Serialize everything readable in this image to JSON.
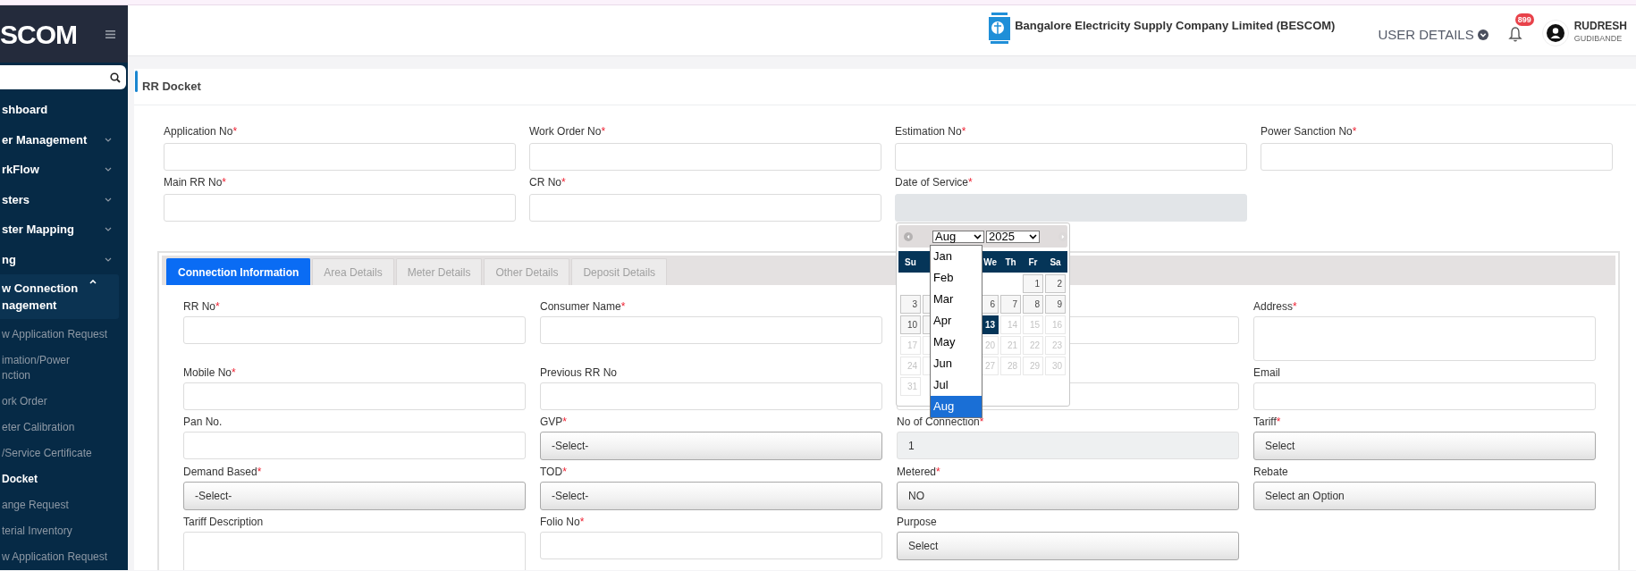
{
  "sidebar": {
    "brand": "SCOM",
    "items": [
      {
        "kind": "link",
        "lines": [
          "shboard"
        ]
      },
      {
        "kind": "group",
        "lines": [
          "er Management"
        ],
        "expanded": false
      },
      {
        "kind": "group",
        "lines": [
          "rkFlow"
        ],
        "expanded": false
      },
      {
        "kind": "group",
        "lines": [
          "sters"
        ],
        "expanded": false
      },
      {
        "kind": "group",
        "lines": [
          "ster Mapping"
        ],
        "expanded": false
      },
      {
        "kind": "group",
        "lines": [
          "ng"
        ],
        "expanded": false
      },
      {
        "kind": "group",
        "lines": [
          "w Connection",
          "nagement"
        ],
        "expanded": true,
        "children": [
          {
            "lines": [
              "w Application Request"
            ],
            "selected": false
          },
          {
            "lines": [
              "imation/Power",
              "nction"
            ],
            "selected": false
          },
          {
            "lines": [
              "ork Order"
            ],
            "selected": false
          },
          {
            "lines": [
              "eter Calibration"
            ],
            "selected": false
          },
          {
            "lines": [
              "/Service Certificate"
            ],
            "selected": false
          },
          {
            "lines": [
              "Docket"
            ],
            "selected": true
          },
          {
            "lines": [
              "ange Request"
            ],
            "selected": false
          },
          {
            "lines": [
              "terial Inventory"
            ],
            "selected": false
          },
          {
            "lines": [
              "w Application Request"
            ],
            "selected": false
          }
        ]
      }
    ]
  },
  "header": {
    "company": "Bangalore Electricity Supply Company Limited (BESCOM)",
    "user_menu": "USER DETAILS",
    "notifications": "899",
    "user": {
      "name": "RUDRESH",
      "location": "GUDIBANDE"
    }
  },
  "page_title": "RR Docket",
  "fields": [
    {
      "label": "Application No",
      "mark": "*",
      "kind": "input"
    },
    {
      "label": "Work Order No",
      "mark": "*",
      "kind": "input"
    },
    {
      "label": "Estimation No",
      "mark": "*",
      "kind": "input"
    },
    {
      "label": "Power Sanction No",
      "mark": "*",
      "kind": "input"
    },
    {
      "label": "Main RR No",
      "mark": "*",
      "kind": "input"
    },
    {
      "label": "CR No",
      "mark": "*",
      "kind": "input"
    },
    {
      "label": "Date of Service",
      "mark": "*",
      "kind": "date"
    }
  ],
  "calendar": {
    "month": "Aug",
    "year": "2025",
    "weekdays": [
      {
        "kind": "label",
        "label": "Su"
      },
      {
        "kind": "covered"
      },
      {
        "kind": "covered"
      },
      {
        "kind": "label",
        "label": "We"
      },
      {
        "kind": "label",
        "label": "Th"
      },
      {
        "kind": "label",
        "label": "Fr"
      },
      {
        "kind": "label",
        "label": "Sa"
      }
    ],
    "weeks": [
      [
        {
          "kind": "empty"
        },
        {
          "kind": "empty"
        },
        {
          "kind": "empty"
        },
        {
          "kind": "empty"
        },
        {
          "kind": "empty"
        },
        {
          "kind": "day",
          "day": "1",
          "selected": false
        },
        {
          "kind": "day",
          "day": "2",
          "selected": false
        }
      ],
      [
        {
          "kind": "day",
          "day": "3",
          "selected": false
        },
        {
          "kind": "day"
        },
        {
          "kind": "covered"
        },
        {
          "kind": "day",
          "day": "6",
          "selected": false
        },
        {
          "kind": "day",
          "day": "7",
          "selected": false
        },
        {
          "kind": "day",
          "day": "8",
          "selected": false
        },
        {
          "kind": "day",
          "day": "9",
          "selected": false
        }
      ],
      [
        {
          "kind": "day",
          "day": "10",
          "selected": false
        },
        {
          "kind": "day"
        },
        {
          "kind": "covered"
        },
        {
          "kind": "day",
          "day": "13",
          "selected": true
        },
        {
          "kind": "disabled",
          "day": "14",
          "selected": false
        },
        {
          "kind": "disabled",
          "day": "15",
          "selected": false
        },
        {
          "kind": "disabled",
          "day": "16",
          "selected": false
        }
      ],
      [
        {
          "kind": "disabled",
          "day": "17",
          "selected": false
        },
        {
          "kind": "disabled"
        },
        {
          "kind": "covered"
        },
        {
          "kind": "disabled",
          "day": "20",
          "selected": false
        },
        {
          "kind": "disabled",
          "day": "21",
          "selected": false
        },
        {
          "kind": "disabled",
          "day": "22",
          "selected": false
        },
        {
          "kind": "disabled",
          "day": "23",
          "selected": false
        }
      ],
      [
        {
          "kind": "disabled",
          "day": "24",
          "selected": false
        },
        {
          "kind": "disabled"
        },
        {
          "kind": "covered"
        },
        {
          "kind": "disabled",
          "day": "27",
          "selected": false
        },
        {
          "kind": "disabled",
          "day": "28",
          "selected": false
        },
        {
          "kind": "disabled",
          "day": "29",
          "selected": false
        },
        {
          "kind": "disabled",
          "day": "30",
          "selected": false
        }
      ],
      [
        {
          "kind": "disabled",
          "day": "31",
          "selected": false
        },
        {
          "kind": "empty"
        },
        {
          "kind": "empty"
        },
        {
          "kind": "empty"
        },
        {
          "kind": "empty"
        },
        {
          "kind": "empty"
        },
        {
          "kind": "empty"
        }
      ]
    ],
    "month_options": [
      {
        "label": "Jan",
        "selected": false
      },
      {
        "label": "Feb",
        "selected": false
      },
      {
        "label": "Mar",
        "selected": false
      },
      {
        "label": "Apr",
        "selected": false
      },
      {
        "label": "May",
        "selected": false
      },
      {
        "label": "Jun",
        "selected": false
      },
      {
        "label": "Jul",
        "selected": false
      },
      {
        "label": "Aug",
        "selected": true
      }
    ]
  },
  "tabs": [
    {
      "label": "Connection Information",
      "selected": true
    },
    {
      "label": "Area Details",
      "selected": false
    },
    {
      "label": "Meter Details",
      "selected": false
    },
    {
      "label": "Other Details",
      "selected": false
    },
    {
      "label": "Deposit Details",
      "selected": false
    }
  ],
  "tab_fields": [
    {
      "label": "RR No",
      "mark": "*",
      "kind": "input"
    },
    {
      "label": "Consumer Name",
      "mark": "*",
      "kind": "input"
    },
    {
      "kind": "input"
    },
    {
      "label": "Address",
      "mark": "*",
      "kind": "textarea"
    },
    {
      "label": "Mobile No",
      "mark": "*",
      "kind": "input"
    },
    {
      "label": "Previous RR No",
      "kind": "input"
    },
    {
      "kind": "input"
    },
    {
      "label": "Email",
      "kind": "input"
    },
    {
      "label": "Pan No.",
      "kind": "input"
    },
    {
      "label": "GVP",
      "mark": "*",
      "kind": "select",
      "value": "-Select-"
    },
    {
      "label": "No of Connection",
      "mark": "*",
      "kind": "readonly",
      "value": "1"
    },
    {
      "label": "Tariff",
      "mark": "*",
      "kind": "select",
      "value": "Select"
    },
    {
      "label": "Demand Based",
      "mark": "*",
      "kind": "select",
      "value": "-Select-"
    },
    {
      "label": "TOD",
      "mark": "*",
      "kind": "select",
      "value": "-Select-"
    },
    {
      "label": "Metered",
      "mark": "*",
      "kind": "select",
      "value": "NO"
    },
    {
      "label": "Rebate",
      "kind": "select",
      "value": "Select an Option"
    },
    {
      "label": "Tariff Description",
      "kind": "textarea"
    },
    {
      "label": "Folio No",
      "mark": "*",
      "kind": "input"
    },
    {
      "label": "Purpose",
      "kind": "select",
      "value": "Select"
    }
  ]
}
